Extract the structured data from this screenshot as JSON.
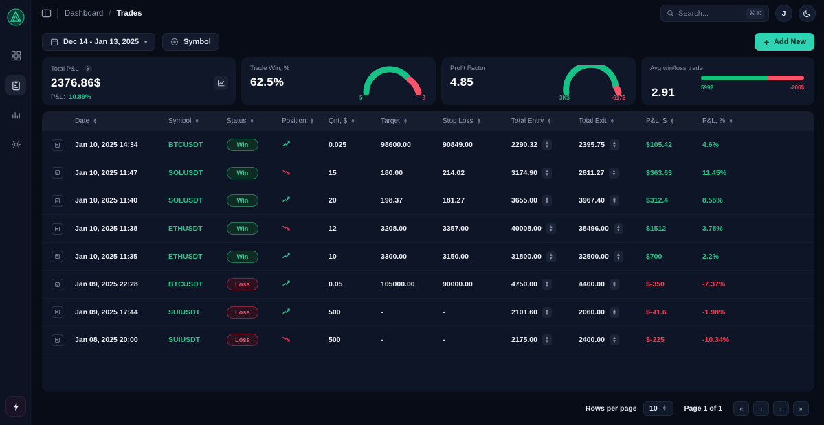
{
  "brand": {
    "logo_icon": "triangle-logo",
    "accent": "#2dd4b4"
  },
  "sidebar": {
    "items": [
      {
        "icon": "grid-dashboard-icon",
        "name": "dashboard",
        "active": false
      },
      {
        "icon": "clipboard-trades-icon",
        "name": "trades",
        "active": true
      },
      {
        "icon": "bar-chart-stats-icon",
        "name": "statistics",
        "active": false
      },
      {
        "icon": "gear-settings-icon",
        "name": "settings",
        "active": false
      }
    ],
    "bottom": {
      "icon": "lightning-bolt-icon",
      "name": "upgrade"
    }
  },
  "topbar": {
    "panel_toggle_icon": "panel-left-icon",
    "breadcrumb": {
      "parent": "Dashboard",
      "separator": "/",
      "current": "Trades"
    },
    "search": {
      "placeholder": "Search...",
      "icon": "search-icon",
      "shortcut": "⌘ K"
    },
    "avatar_initial": "J",
    "theme_toggle_icon": "moon-icon"
  },
  "toolbar": {
    "date_range": {
      "icon": "calendar-icon",
      "label": "Dec 14 - Jan 13, 2025",
      "chevron": "▾"
    },
    "symbol_filter": {
      "icon": "plus-circle-icon",
      "label": "Symbol"
    },
    "add_new": {
      "icon": "plus-icon",
      "label": "Add New"
    }
  },
  "cards": [
    {
      "label": "Total P&L",
      "badge_icon": "bitcoin-icon",
      "value": "2376.86$",
      "sub_label": "P&L:",
      "sub_value": "10.89%",
      "action_icon": "line-chart-icon"
    },
    {
      "label": "Trade Win, %",
      "value": "62.5%",
      "gauge": {
        "left_label": "5",
        "right_label": "3",
        "green_fraction": 0.68
      }
    },
    {
      "label": "Profit Factor",
      "value": "4.85",
      "gauge": {
        "left_label": "3K$",
        "right_label": "-617$",
        "green_fraction": 0.83
      }
    },
    {
      "label": "Avg win/loss trade",
      "value": "2.91",
      "bar": {
        "left_label": "599$",
        "right_label": "-206$",
        "green_fraction": 0.65
      }
    }
  ],
  "table": {
    "columns": [
      {
        "label": "",
        "sortable": false
      },
      {
        "label": "Date",
        "sortable": true
      },
      {
        "label": "Symbol",
        "sortable": true
      },
      {
        "label": "Status",
        "sortable": true
      },
      {
        "label": "Position",
        "sortable": true
      },
      {
        "label": "Qnt, $",
        "sortable": true
      },
      {
        "label": "Target",
        "sortable": true
      },
      {
        "label": "Stop Loss",
        "sortable": true
      },
      {
        "label": "Total Entry",
        "sortable": true
      },
      {
        "label": "Total Exit",
        "sortable": true
      },
      {
        "label": "P&L, $",
        "sortable": true
      },
      {
        "label": "P&L, %",
        "sortable": true
      }
    ],
    "rows": [
      {
        "action_icon": "note-icon",
        "date": "Jan 10, 2025 14:34",
        "symbol": "BTCUSDT",
        "status": "Win",
        "position": "long",
        "qnt": "0.025",
        "target": "98600.00",
        "stop_loss": "90849.00",
        "total_entry": "2290.32",
        "total_exit": "2395.75",
        "pnl_usd": "$105.42",
        "pnl_pct": "4.6%",
        "profit": true
      },
      {
        "action_icon": "note-icon",
        "date": "Jan 10, 2025 11:47",
        "symbol": "SOLUSDT",
        "status": "Win",
        "position": "short",
        "qnt": "15",
        "target": "180.00",
        "stop_loss": "214.02",
        "total_entry": "3174.90",
        "total_exit": "2811.27",
        "pnl_usd": "$363.63",
        "pnl_pct": "11.45%",
        "profit": true
      },
      {
        "action_icon": "note-icon",
        "date": "Jan 10, 2025 11:40",
        "symbol": "SOLUSDT",
        "status": "Win",
        "position": "long",
        "qnt": "20",
        "target": "198.37",
        "stop_loss": "181.27",
        "total_entry": "3655.00",
        "total_exit": "3967.40",
        "pnl_usd": "$312.4",
        "pnl_pct": "8.55%",
        "profit": true
      },
      {
        "action_icon": "note-icon",
        "date": "Jan 10, 2025 11:38",
        "symbol": "ETHUSDT",
        "status": "Win",
        "position": "short",
        "qnt": "12",
        "target": "3208.00",
        "stop_loss": "3357.00",
        "total_entry": "40008.00",
        "total_exit": "38496.00",
        "pnl_usd": "$1512",
        "pnl_pct": "3.78%",
        "profit": true
      },
      {
        "action_icon": "note-icon",
        "date": "Jan 10, 2025 11:35",
        "symbol": "ETHUSDT",
        "status": "Win",
        "position": "long",
        "qnt": "10",
        "target": "3300.00",
        "stop_loss": "3150.00",
        "total_entry": "31800.00",
        "total_exit": "32500.00",
        "pnl_usd": "$700",
        "pnl_pct": "2.2%",
        "profit": true
      },
      {
        "action_icon": "note-icon",
        "date": "Jan 09, 2025 22:28",
        "symbol": "BTCUSDT",
        "status": "Loss",
        "position": "long",
        "qnt": "0.05",
        "target": "105000.00",
        "stop_loss": "90000.00",
        "total_entry": "4750.00",
        "total_exit": "4400.00",
        "pnl_usd": "$-350",
        "pnl_pct": "-7.37%",
        "profit": false
      },
      {
        "action_icon": "note-icon",
        "date": "Jan 09, 2025 17:44",
        "symbol": "SUIUSDT",
        "status": "Loss",
        "position": "long",
        "qnt": "500",
        "target": "-",
        "stop_loss": "-",
        "total_entry": "2101.60",
        "total_exit": "2060.00",
        "pnl_usd": "$-41.6",
        "pnl_pct": "-1.98%",
        "profit": false
      },
      {
        "action_icon": "note-icon",
        "date": "Jan 08, 2025 20:00",
        "symbol": "SUIUSDT",
        "status": "Loss",
        "position": "short",
        "qnt": "500",
        "target": "-",
        "stop_loss": "-",
        "total_entry": "2175.00",
        "total_exit": "2400.00",
        "pnl_usd": "$-225",
        "pnl_pct": "-10.34%",
        "profit": false
      }
    ]
  },
  "footer": {
    "rows_per_page_label": "Rows per page",
    "rows_per_page_value": "10",
    "page_info": "Page 1 of 1",
    "buttons": [
      {
        "icon": "chevrons-left-icon",
        "glyph": "«"
      },
      {
        "icon": "chevron-left-icon",
        "glyph": "‹"
      },
      {
        "icon": "chevron-right-icon",
        "glyph": "›"
      },
      {
        "icon": "chevrons-right-icon",
        "glyph": "»"
      }
    ]
  },
  "colors": {
    "green": "#23c589",
    "red": "#ef3b52",
    "accent": "#2dd4b4"
  }
}
